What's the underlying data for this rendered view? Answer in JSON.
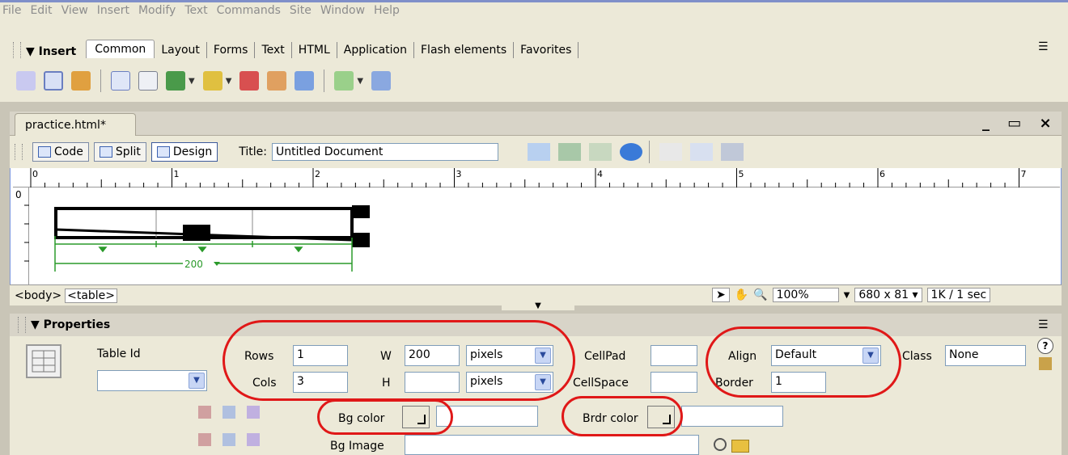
{
  "menu": [
    "File",
    "Edit",
    "View",
    "Insert",
    "Modify",
    "Text",
    "Commands",
    "Site",
    "Window",
    "Help"
  ],
  "insert_panel": {
    "title": "Insert",
    "tabs": [
      "Common",
      "Layout",
      "Forms",
      "Text",
      "HTML",
      "Application",
      "Flash elements",
      "Favorites"
    ],
    "active_tab": "Common"
  },
  "document": {
    "tab_title": "practice.html*",
    "window_controls": "_ ▭ ×",
    "views": {
      "code": "Code",
      "split": "Split",
      "design": "Design"
    },
    "title_label": "Title:",
    "title_value": "Untitled Document",
    "ruler_marks": [
      "0",
      "1",
      "2",
      "3",
      "4",
      "5",
      "6",
      "7"
    ],
    "ruler_left_mark": "0",
    "table_width_label": "200"
  },
  "status": {
    "tags": [
      "<body>",
      "<table>"
    ],
    "zoom": "100%",
    "size": "680 x 81",
    "download": "1K / 1 sec"
  },
  "properties": {
    "title": "Properties",
    "table_id_label": "Table Id",
    "rows_label": "Rows",
    "rows_value": "1",
    "cols_label": "Cols",
    "cols_value": "3",
    "w_label": "W",
    "w_value": "200",
    "h_label": "H",
    "h_value": "",
    "w_unit": "pixels",
    "h_unit": "pixels",
    "cellpad_label": "CellPad",
    "cellspace_label": "CellSpace",
    "align_label": "Align",
    "align_value": "Default",
    "border_label": "Border",
    "border_value": "1",
    "class_label": "Class",
    "class_value": "None",
    "bgcolor_label": "Bg color",
    "brdrcolor_label": "Brdr color",
    "bgimage_label": "Bg Image"
  },
  "colors": {
    "annotation": "#e01818",
    "accent": "#7a96df",
    "dimension_line": "#2a9a2a"
  }
}
